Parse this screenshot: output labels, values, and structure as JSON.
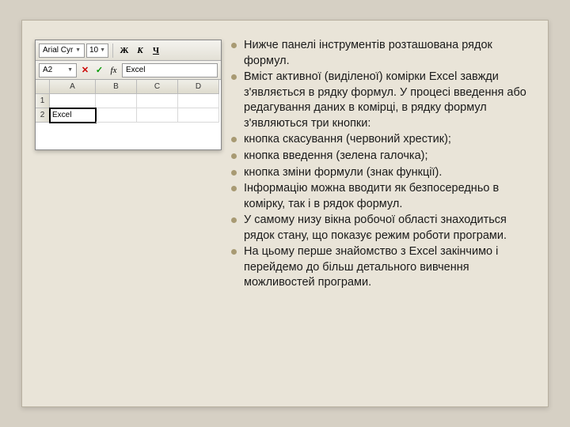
{
  "excel": {
    "font_name": "Arial Cyr",
    "font_size": "10",
    "bold_label": "Ж",
    "italic_label": "К",
    "underline_label": "Ч",
    "cell_ref": "A2",
    "fx_label": "fx",
    "formula_value": "Excel",
    "cols": [
      "A",
      "B",
      "C",
      "D"
    ],
    "rows": [
      "1",
      "2"
    ],
    "active_cell_value": "Excel"
  },
  "bullets": [
    "Нижче панелі інструментів розташована рядок формул.",
    "Вміст активної (виділеної) комірки Excel завжди з'являється в рядку формул. У процесі введення або редагування даних в комірці, в рядку формул з'являються три кнопки:",
    "кнопка скасування (червоний хрестик);",
    "кнопка введення (зелена галочка);",
    "кнопка зміни формули (знак функції).",
    "Інформацію можна вводити як безпосередньо в комірку, так і в рядок формул.",
    "У самому низу вікна робочої області знаходиться рядок стану, що показує режим роботи програми.",
    "На цьому перше знайомство з Excel закінчимо і перейдемо до більш детального вивчення можливостей програми."
  ]
}
